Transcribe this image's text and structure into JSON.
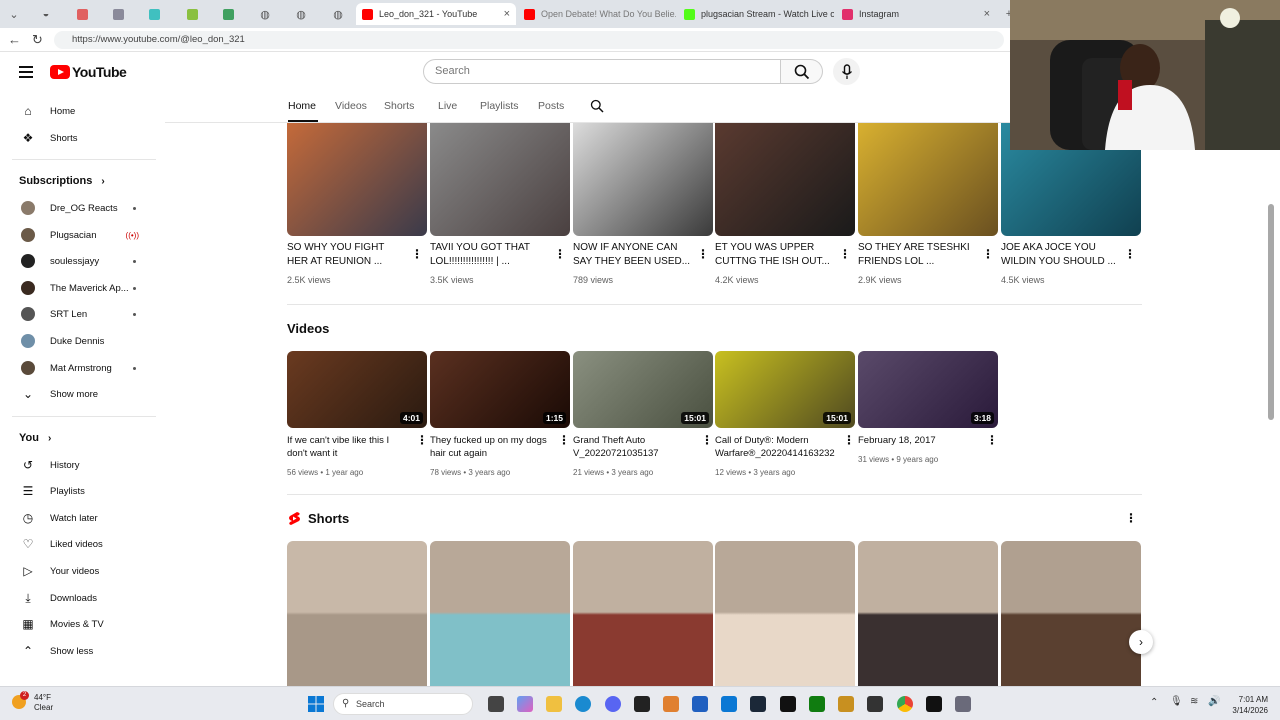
{
  "browser": {
    "tabs": [
      {
        "title": "Leo_don_321 - YouTube",
        "active": true,
        "favicon_color": "#ff0000"
      },
      {
        "title": "Open Debate! What Do You Belie...",
        "active": false,
        "favicon_color": "#ff0000"
      },
      {
        "title": "plugsacian Stream - Watch Live on...",
        "active": false,
        "favicon_color": "#53fc18"
      },
      {
        "title": "Instagram",
        "active": false,
        "favicon_color": "#e1306c"
      }
    ],
    "url": "https://www.youtube.com/@leo_don_321"
  },
  "header": {
    "logo_text": "YouTube",
    "search_placeholder": "Search"
  },
  "channel_tabs": [
    "Home",
    "Videos",
    "Shorts",
    "Live",
    "Playlists",
    "Posts"
  ],
  "sidebar": {
    "top_items": [
      {
        "label": "Home",
        "icon": "home-icon"
      },
      {
        "label": "Shorts",
        "icon": "shorts-icon"
      }
    ],
    "subscriptions_title": "Subscriptions",
    "subscriptions": [
      {
        "label": "Dre_OG Reacts",
        "status": "dot",
        "avatar_color": "#8a7a6a"
      },
      {
        "label": "Plugsacian",
        "status": "live",
        "avatar_color": "#6b5a48"
      },
      {
        "label": "soulessjayy",
        "status": "dot",
        "avatar_color": "#222222"
      },
      {
        "label": "The Maverick Ap...",
        "status": "dot",
        "avatar_color": "#3a2a20"
      },
      {
        "label": "SRT Len",
        "status": "dot",
        "avatar_color": "#555555"
      },
      {
        "label": "Duke Dennis",
        "status": "none",
        "avatar_color": "#6f8fa8"
      },
      {
        "label": "Mat Armstrong",
        "status": "dot",
        "avatar_color": "#5a4a3a"
      }
    ],
    "show_more": "Show more",
    "you_title": "You",
    "you_items": [
      {
        "label": "History",
        "icon": "history-icon"
      },
      {
        "label": "Playlists",
        "icon": "playlists-icon"
      },
      {
        "label": "Watch later",
        "icon": "watch-later-icon"
      },
      {
        "label": "Liked videos",
        "icon": "like-icon"
      },
      {
        "label": "Your videos",
        "icon": "your-videos-icon"
      },
      {
        "label": "Downloads",
        "icon": "download-icon"
      },
      {
        "label": "Movies & TV",
        "icon": "movies-icon"
      }
    ],
    "show_less": "Show less"
  },
  "top_row": [
    {
      "line1": "SO WHY YOU FIGHT",
      "line2": "HER AT REUNION ...",
      "views": "2.5K views",
      "colors": [
        "#c46a3a",
        "#3a3a4a"
      ]
    },
    {
      "line1": "TAVII YOU GOT THAT",
      "line2": "LOL!!!!!!!!!!!!!!!! | ...",
      "views": "3.5K views",
      "colors": [
        "#8a8a8a",
        "#4a4040"
      ]
    },
    {
      "line1": "NOW IF ANYONE CAN",
      "line2": "SAY THEY BEEN USED...",
      "views": "789 views",
      "colors": [
        "#dcdcdc",
        "#3a3a3a"
      ]
    },
    {
      "line1": "ET YOU WAS UPPER",
      "line2": "CUTTNG THE ISH OUT...",
      "views": "4.2K views",
      "colors": [
        "#5a3a30",
        "#1a1a1a"
      ]
    },
    {
      "line1": "SO THEY ARE TSESHKI",
      "line2": "FRIENDS LOL ...",
      "views": "2.9K views",
      "colors": [
        "#d8b030",
        "#6a5020"
      ]
    },
    {
      "line1": "JOE AKA JOCE YOU",
      "line2": "WILDIN YOU SHOULD ...",
      "views": "4.5K views",
      "colors": [
        "#2a8aa0",
        "#104050"
      ]
    }
  ],
  "videos_section": {
    "title": "Videos",
    "items": [
      {
        "line1": "If we can't vibe like this I",
        "line2": "don't want it",
        "meta": "56 views • 1 year ago",
        "duration": "4:01",
        "colors": [
          "#6a3a20",
          "#2a1a10"
        ]
      },
      {
        "line1": "They fucked up on my dogs",
        "line2": "hair cut again",
        "meta": "78 views • 3 years ago",
        "duration": "1:15",
        "colors": [
          "#5a3020",
          "#1a0a05"
        ]
      },
      {
        "line1": "Grand Theft Auto",
        "line2": "V_20220721035137",
        "meta": "21 views • 3 years ago",
        "duration": "15:01",
        "colors": [
          "#8a9080",
          "#4a5040"
        ]
      },
      {
        "line1": "Call of Duty®: Modern",
        "line2": "Warfare®_20220414163232",
        "meta": "12 views • 3 years ago",
        "duration": "15:01",
        "colors": [
          "#c8c020",
          "#504a20"
        ]
      },
      {
        "line1": "February 18, 2017",
        "line2": "",
        "meta": "31 views • 9 years ago",
        "duration": "3:18",
        "colors": [
          "#5a4a6a",
          "#2a1a3a"
        ]
      }
    ]
  },
  "shorts_section": {
    "title": "Shorts",
    "items": [
      {
        "colors": [
          "#c8b8a8",
          "#a89888"
        ]
      },
      {
        "colors": [
          "#b8a898",
          "#80c0c8"
        ]
      },
      {
        "colors": [
          "#c0b0a0",
          "#8a3a30"
        ]
      },
      {
        "colors": [
          "#b8a898",
          "#e8d8c8"
        ]
      },
      {
        "colors": [
          "#c0b0a0",
          "#3a3030"
        ]
      },
      {
        "colors": [
          "#b0a090",
          "#5a4030"
        ]
      }
    ]
  },
  "taskbar": {
    "weather_temp": "44°F",
    "weather_desc": "Clear",
    "weather_badge": "2",
    "search_label": "Search",
    "time": "7:01 AM",
    "date": "3/14/2026"
  }
}
